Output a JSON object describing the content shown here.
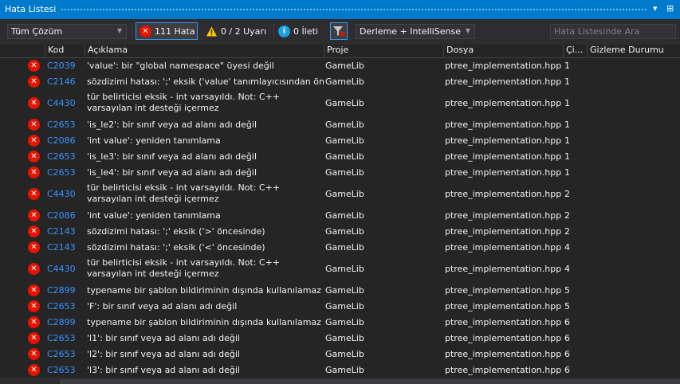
{
  "window": {
    "title": "Hata Listesi"
  },
  "toolbar": {
    "scope": "Tüm Çözüm",
    "errors_label": "111 Hata",
    "warnings_label": "0 / 2 Uyarı",
    "messages_label": "0 İleti",
    "source": "Derleme + IntelliSense",
    "search_placeholder": "Hata Listesinde Ara"
  },
  "columns": {
    "code": "Kod",
    "description": "Açıklama",
    "project": "Proje",
    "file": "Dosya",
    "line": "Çi...",
    "suppression": "Gizleme Durumu"
  },
  "rows": [
    {
      "code": "C2039",
      "desc": "'value': bir \"global namespace\" üyesi değil",
      "project": "GameLib",
      "file": "ptree_implementation.hpp",
      "line": "1"
    },
    {
      "code": "C2146",
      "desc": "sözdizimi hatası: ';' eksik ('value' tanımlayıcısından önce)",
      "project": "GameLib",
      "file": "ptree_implementation.hpp",
      "line": "1"
    },
    {
      "code": "C4430",
      "desc": "tür belirticisi eksik - int varsayıldı. Not: C++ varsayılan int desteği içermez",
      "project": "GameLib",
      "file": "ptree_implementation.hpp",
      "line": "1"
    },
    {
      "code": "C2653",
      "desc": "'is_le2': bir sınıf veya ad alanı adı değil",
      "project": "GameLib",
      "file": "ptree_implementation.hpp",
      "line": "1"
    },
    {
      "code": "C2086",
      "desc": "'int value': yeniden tanımlama",
      "project": "GameLib",
      "file": "ptree_implementation.hpp",
      "line": "1"
    },
    {
      "code": "C2653",
      "desc": "'is_le3': bir sınıf veya ad alanı adı değil",
      "project": "GameLib",
      "file": "ptree_implementation.hpp",
      "line": "1"
    },
    {
      "code": "C2653",
      "desc": "'is_le4': bir sınıf veya ad alanı adı değil",
      "project": "GameLib",
      "file": "ptree_implementation.hpp",
      "line": "1"
    },
    {
      "code": "C4430",
      "desc": "tür belirticisi eksik - int varsayıldı. Not: C++ varsayılan int desteği içermez",
      "project": "GameLib",
      "file": "ptree_implementation.hpp",
      "line": "2"
    },
    {
      "code": "C2086",
      "desc": "'int value': yeniden tanımlama",
      "project": "GameLib",
      "file": "ptree_implementation.hpp",
      "line": "2"
    },
    {
      "code": "C2143",
      "desc": "sözdizimi hatası: ';' eksik ('>' öncesinde)",
      "project": "GameLib",
      "file": "ptree_implementation.hpp",
      "line": "2"
    },
    {
      "code": "C2143",
      "desc": "sözdizimi hatası: ';' eksik ('<' öncesinde)",
      "project": "GameLib",
      "file": "ptree_implementation.hpp",
      "line": "4"
    },
    {
      "code": "C4430",
      "desc": "tür belirticisi eksik - int varsayıldı. Not: C++ varsayılan int desteği içermez",
      "project": "GameLib",
      "file": "ptree_implementation.hpp",
      "line": "4"
    },
    {
      "code": "C2899",
      "desc": "typename bir şablon bildiriminin dışında kullanılamaz",
      "project": "GameLib",
      "file": "ptree_implementation.hpp",
      "line": "5"
    },
    {
      "code": "C2653",
      "desc": "'F': bir sınıf veya ad alanı adı değil",
      "project": "GameLib",
      "file": "ptree_implementation.hpp",
      "line": "5"
    },
    {
      "code": "C2899",
      "desc": "typename bir şablon bildiriminin dışında kullanılamaz",
      "project": "GameLib",
      "file": "ptree_implementation.hpp",
      "line": "6"
    },
    {
      "code": "C2653",
      "desc": "'l1': bir sınıf veya ad alanı adı değil",
      "project": "GameLib",
      "file": "ptree_implementation.hpp",
      "line": "6"
    },
    {
      "code": "C2653",
      "desc": "'l2': bir sınıf veya ad alanı adı değil",
      "project": "GameLib",
      "file": "ptree_implementation.hpp",
      "line": "6"
    },
    {
      "code": "C2653",
      "desc": "'l3': bir sınıf veya ad alanı adı değil",
      "project": "GameLib",
      "file": "ptree_implementation.hpp",
      "line": "6"
    }
  ],
  "colors": {
    "titlebar": "#007acc",
    "background": "#252526",
    "error_icon": "#e51400",
    "code_link": "#3794ff"
  }
}
